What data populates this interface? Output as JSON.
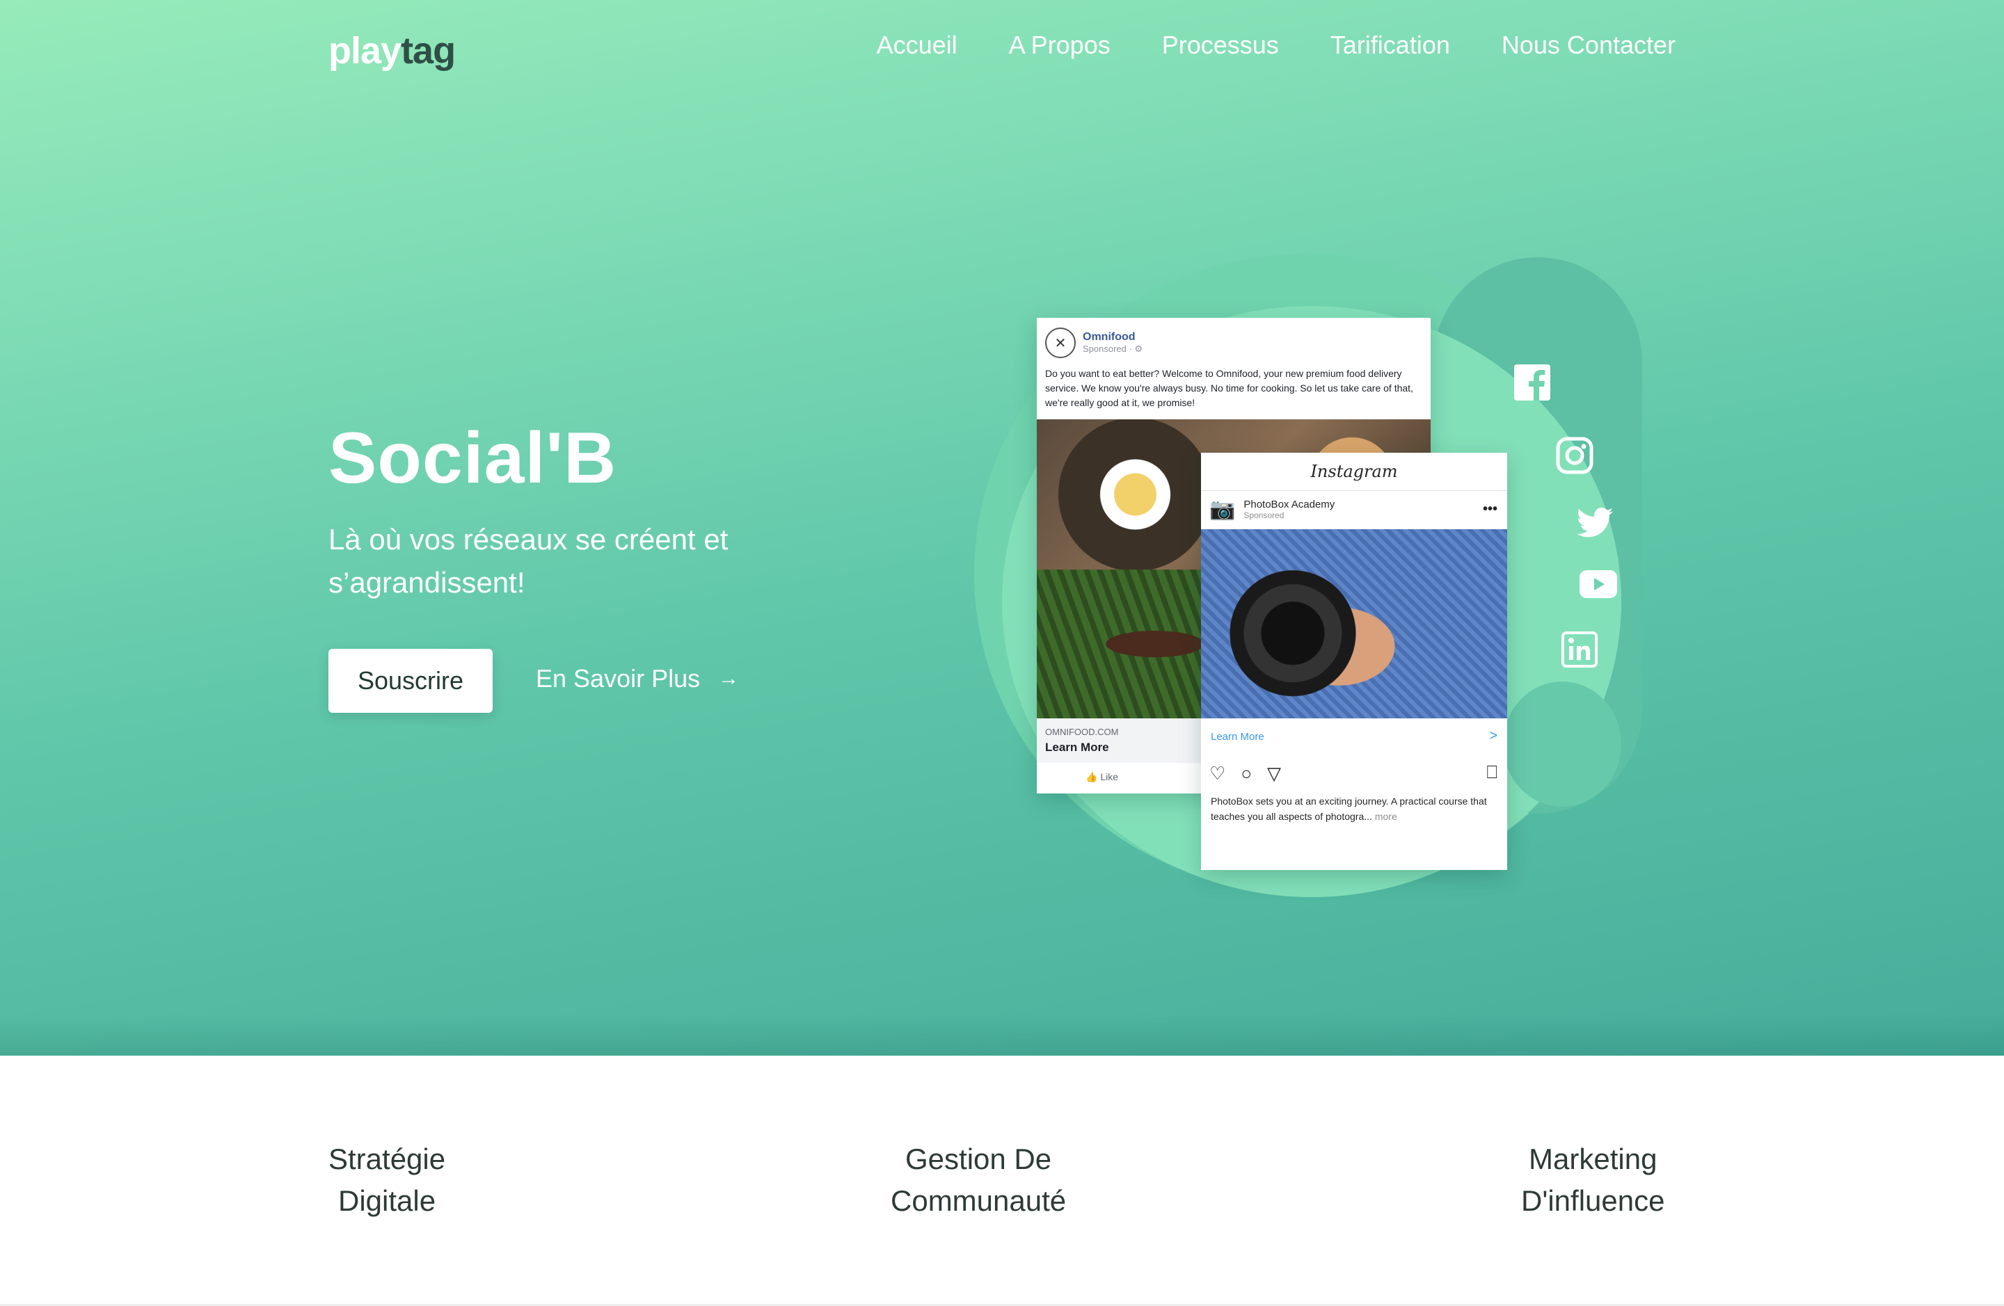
{
  "brand": {
    "part1": "play",
    "part2": "tag"
  },
  "nav": {
    "items": [
      "Accueil",
      "A Propos",
      "Processus",
      "Tarification",
      "Nous Contacter"
    ]
  },
  "hero": {
    "title": "Social'B",
    "subtitle": "Là où vos réseaux se créent et s’agrandissent!",
    "primary_button": "Souscrire",
    "secondary_button": "En Savoir Plus",
    "secondary_arrow": "→"
  },
  "facebook_ad": {
    "page_name": "Omnifood",
    "sponsored": "Sponsored · ⚙",
    "text": "Do you want to eat better? Welcome to Omnifood, your new premium food delivery service. We know you're always busy. No time for cooking. So let us take care of that, we're really good at it, we promise!",
    "domain": "OMNIFOOD.COM",
    "cta": "Learn More",
    "like": "👍 Like"
  },
  "instagram_ad": {
    "app_name": "Instagram",
    "account": "PhotoBox Academy",
    "sponsored": "Sponsored",
    "dots": "•••",
    "cta": "Learn More",
    "chevron": ">",
    "caption": "PhotoBox sets you at an exciting journey. A practical course that teaches you all aspects of photogra...",
    "more": "more"
  },
  "social_icons": [
    "facebook-icon",
    "instagram-icon",
    "twitter-icon",
    "youtube-icon",
    "linkedin-icon"
  ],
  "features": [
    {
      "line1": "Stratégie",
      "line2": "Digitale"
    },
    {
      "line1": "Gestion De",
      "line2": "Communauté"
    },
    {
      "line1": "Marketing",
      "line2": "D'influence"
    }
  ],
  "colors": {
    "hero_top": "#97ebba",
    "hero_bottom": "#46ad9b",
    "logo_dark": "#2e4f46",
    "text_dark": "#2e3a36"
  }
}
